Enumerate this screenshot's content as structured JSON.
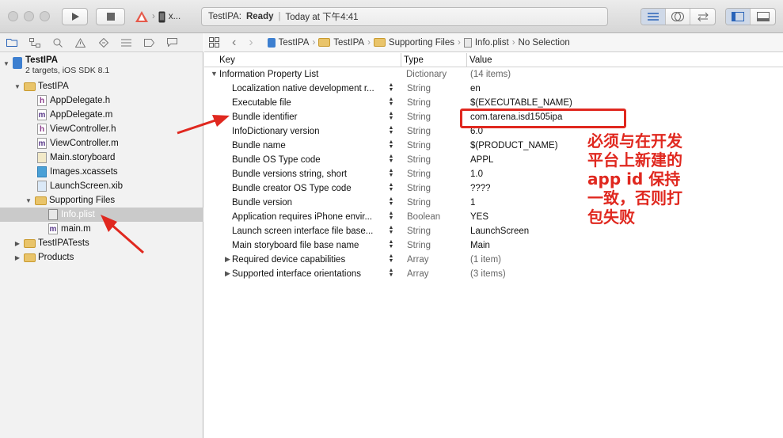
{
  "toolbar": {
    "scheme_label": "x...",
    "activity_project": "TestIPA:",
    "activity_status": "Ready",
    "activity_sep": "|",
    "activity_time": "Today at 下午4:41"
  },
  "navigator": {
    "project_name": "TestIPA",
    "project_subtitle": "2 targets, iOS SDK 8.1",
    "items": [
      {
        "label": "TestIPA"
      },
      {
        "label": "AppDelegate.h"
      },
      {
        "label": "AppDelegate.m"
      },
      {
        "label": "ViewController.h"
      },
      {
        "label": "ViewController.m"
      },
      {
        "label": "Main.storyboard"
      },
      {
        "label": "Images.xcassets"
      },
      {
        "label": "LaunchScreen.xib"
      },
      {
        "label": "Supporting Files"
      },
      {
        "label": "Info.plist"
      },
      {
        "label": "main.m"
      },
      {
        "label": "TestIPATests"
      },
      {
        "label": "Products"
      }
    ]
  },
  "jumpbar": {
    "crumbs": [
      "TestIPA",
      "TestIPA",
      "Supporting Files",
      "Info.plist",
      "No Selection"
    ]
  },
  "plist": {
    "columns": {
      "key": "Key",
      "type": "Type",
      "value": "Value"
    },
    "root": {
      "key": "Information Property List",
      "type": "Dictionary",
      "value": "(14 items)"
    },
    "rows": [
      {
        "key": "Localization native development r...",
        "type": "String",
        "value": "en"
      },
      {
        "key": "Executable file",
        "type": "String",
        "value": "$(EXECUTABLE_NAME)"
      },
      {
        "key": "Bundle identifier",
        "type": "String",
        "value": "com.tarena.isd1505ipa"
      },
      {
        "key": "InfoDictionary version",
        "type": "String",
        "value": "6.0"
      },
      {
        "key": "Bundle name",
        "type": "String",
        "value": "$(PRODUCT_NAME)"
      },
      {
        "key": "Bundle OS Type code",
        "type": "String",
        "value": "APPL"
      },
      {
        "key": "Bundle versions string, short",
        "type": "String",
        "value": "1.0"
      },
      {
        "key": "Bundle creator OS Type code",
        "type": "String",
        "value": "????"
      },
      {
        "key": "Bundle version",
        "type": "String",
        "value": "1"
      },
      {
        "key": "Application requires iPhone envir...",
        "type": "Boolean",
        "value": "YES"
      },
      {
        "key": "Launch screen interface file base...",
        "type": "String",
        "value": "LaunchScreen"
      },
      {
        "key": "Main storyboard file base name",
        "type": "String",
        "value": "Main"
      },
      {
        "key": "Required device capabilities",
        "type": "Array",
        "value": "(1 item)"
      },
      {
        "key": "Supported interface orientations",
        "type": "Array",
        "value": "(3 items)"
      }
    ]
  },
  "annotation": {
    "note": "必须与在开发\n平台上新建的\napp id 保持\n一致，否则打\n包失败",
    "color": "#e0281f"
  }
}
